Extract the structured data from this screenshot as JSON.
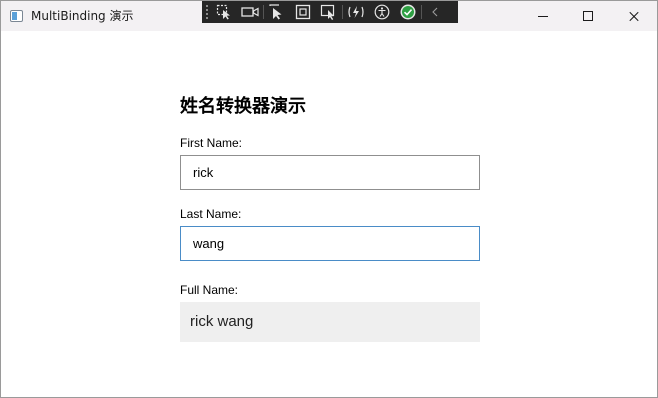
{
  "window": {
    "title": "MultiBinding 演示"
  },
  "debug_toolbar": {
    "items": [
      "select-element-icon",
      "video-icon",
      "pointer-icon",
      "frame-icon",
      "track-focus-icon",
      "hot-reload-icon",
      "accessibility-icon",
      "check-icon",
      "collapse-icon"
    ]
  },
  "form": {
    "heading": "姓名转换器演示",
    "first_name_label": "First Name:",
    "first_name_value": "rick",
    "last_name_label": "Last Name:",
    "last_name_value": "wang",
    "full_name_label": "Full Name:",
    "full_name_value": "rick wang"
  },
  "colors": {
    "focus_border": "#4a8cc7",
    "readonly_background": "#efefef",
    "check_green": "#2ea043"
  }
}
